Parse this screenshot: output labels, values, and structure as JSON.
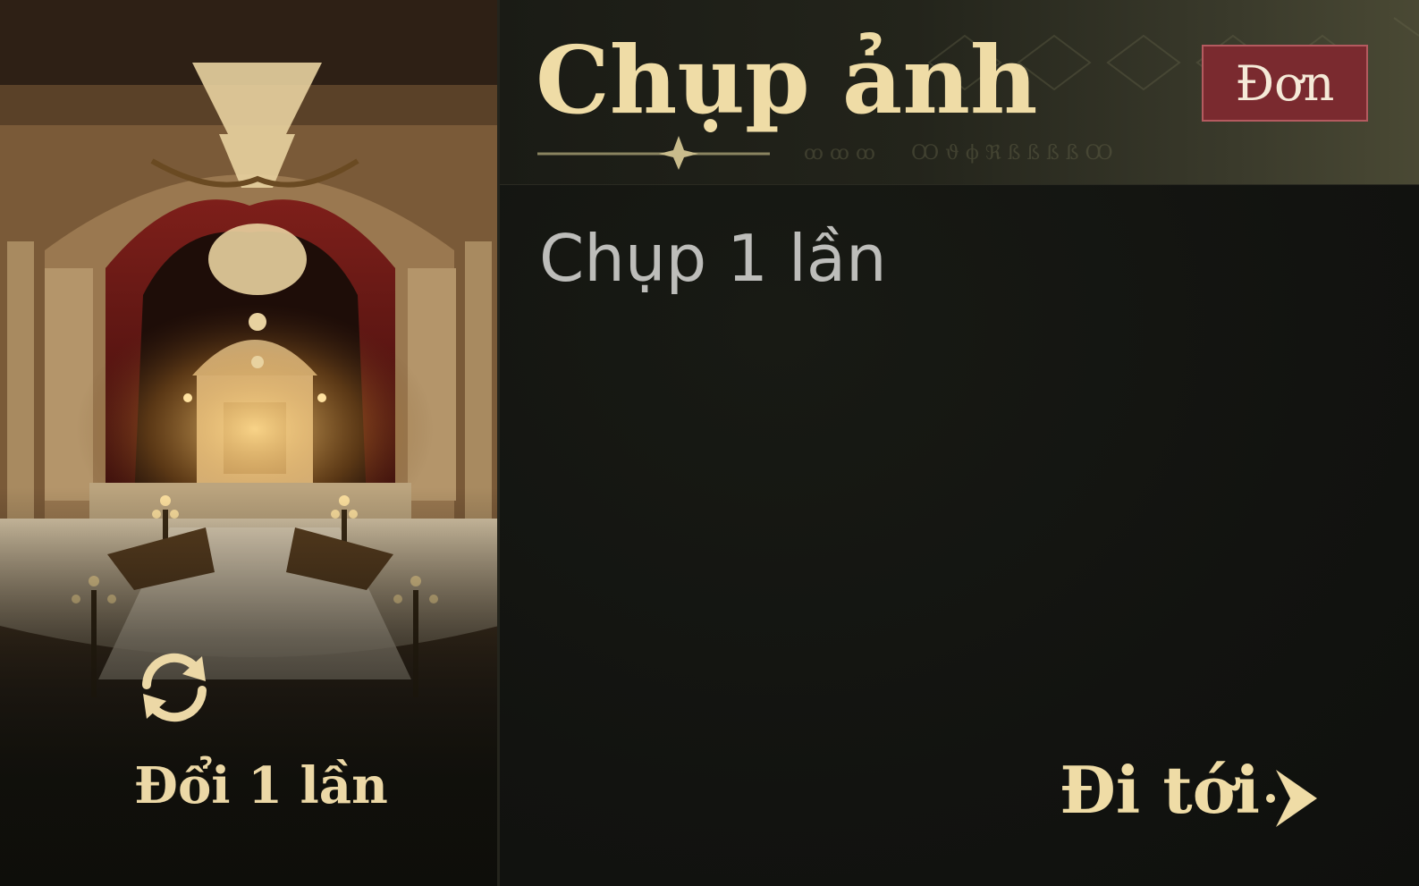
{
  "scene": {
    "swap_label": "Đổi 1 lần",
    "swap_icon": "refresh-arrows-icon"
  },
  "panel": {
    "title": "Chụp ảnh",
    "mode_badge": "Đơn",
    "task": "Chụp 1 lần",
    "go_label": "Đi tới",
    "go_icon": "arrow-right-icon"
  },
  "colors": {
    "gold_text": "#efdca6",
    "badge_bg": "#7a2a2f",
    "task_text": "#bdbdba"
  }
}
